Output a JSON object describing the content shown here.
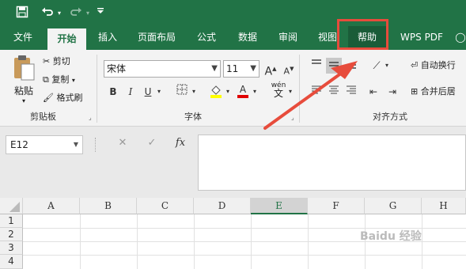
{
  "qat": {
    "save_icon": "save-icon",
    "undo_icon": "undo-icon",
    "redo_icon": "redo-icon",
    "customize_icon": "customize-icon"
  },
  "tabs": [
    {
      "label": "文件"
    },
    {
      "label": "开始"
    },
    {
      "label": "插入"
    },
    {
      "label": "页面布局"
    },
    {
      "label": "公式"
    },
    {
      "label": "数据"
    },
    {
      "label": "审阅"
    },
    {
      "label": "视图"
    },
    {
      "label": "帮助"
    },
    {
      "label": "WPS PDF"
    }
  ],
  "clipboard": {
    "paste": "粘贴",
    "cut": "剪切",
    "copy": "复制",
    "format_painter": "格式刷",
    "group": "剪贴板"
  },
  "font": {
    "name": "宋体",
    "size": "11",
    "bold": "B",
    "italic": "I",
    "underline": "U",
    "grow": "A",
    "shrink": "A",
    "phonetic_top": "wén",
    "phonetic_bottom": "文",
    "group": "字体"
  },
  "alignment": {
    "wrap_text": "自动换行",
    "merge_center": "合并后居",
    "group": "对齐方式"
  },
  "formula_bar": {
    "name_box": "E12",
    "cancel": "✕",
    "enter": "✓",
    "fx": "fx"
  },
  "columns": [
    "A",
    "B",
    "C",
    "D",
    "E",
    "F",
    "G",
    "H"
  ],
  "selected_column": "E",
  "rows": [
    "1",
    "2",
    "3",
    "4"
  ],
  "watermark": "Baidu 经验",
  "colors": {
    "theme": "#217346",
    "highlight": "#e74c3c"
  }
}
